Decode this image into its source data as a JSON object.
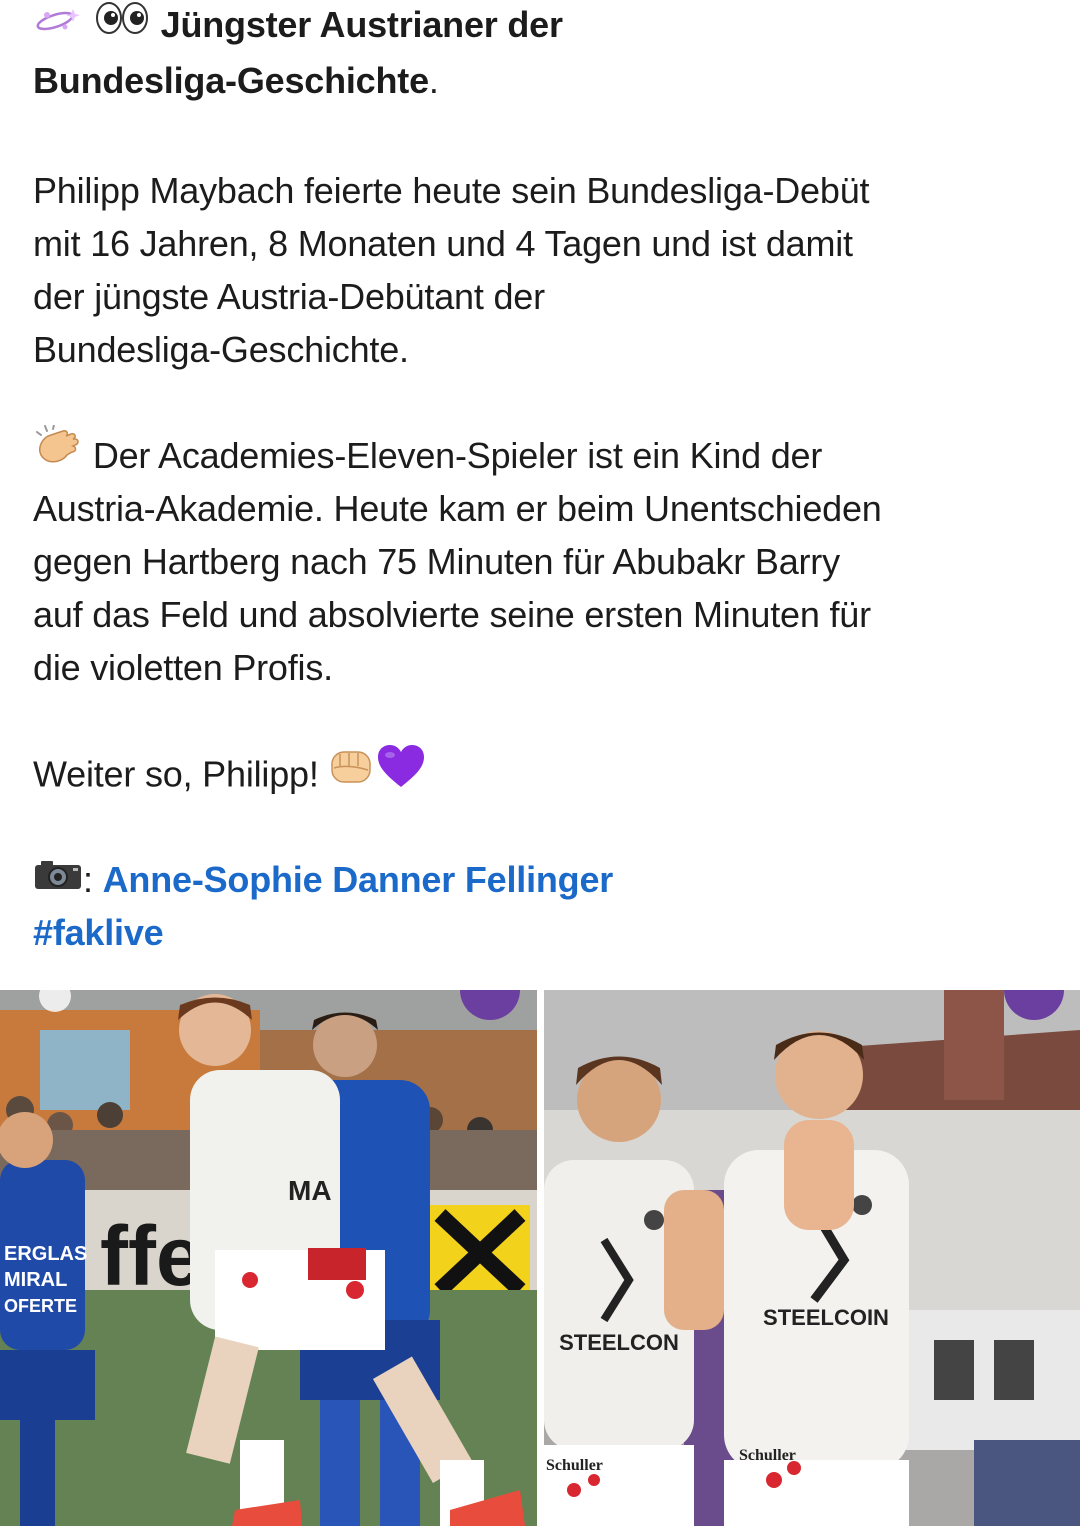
{
  "post": {
    "headline_line1": "Jüngster Austrianer der",
    "headline_line2": "Bundesliga-Geschichte",
    "headline_period": ".",
    "para1": [
      "Philipp Maybach feierte heute sein Bundesliga-Debüt",
      "mit 16 Jahren, 8 Monaten und 4 Tagen und ist damit",
      "der jüngste Austria-Debütant der",
      "Bundesliga-Geschichte."
    ],
    "para2_first": "Der Academies-Eleven-Spieler ist ein Kind der",
    "para2": [
      "Austria-Akademie. Heute kam er beim Unentschieden",
      "gegen Hartberg nach 75 Minuten für Abubakr Barry",
      "auf das Feld und absolvierte seine ersten Minuten für",
      "die violetten Profis."
    ],
    "closing": "Weiter so, Philipp!",
    "credit_separator": ":",
    "credit_name": "Anne-Sophie Danner Fellinger",
    "hashtag": "#faklive"
  },
  "photos": {
    "left": {
      "sponsor_banner": "ffeisen",
      "jersey_text": "MA",
      "ad_board_lines": [
        "ERGLAS",
        "MIRAL",
        "OFERTE"
      ]
    },
    "right": {
      "sponsor_left": "STEELCON",
      "sponsor_right": "STEELCOIN",
      "short_sponsor": "Schuller"
    }
  },
  "icons": {
    "headline": [
      "sparkle-planet-icon",
      "eyes-icon"
    ],
    "clap": "clapping-hands-icon",
    "fist": "fist-bump-icon",
    "heart": "purple-heart-icon",
    "camera": "camera-icon"
  },
  "colors": {
    "link": "#1b6ac9",
    "text": "#1c1c1c",
    "heart": "#8a2be2",
    "austria_violet": "#6a3fa0"
  }
}
